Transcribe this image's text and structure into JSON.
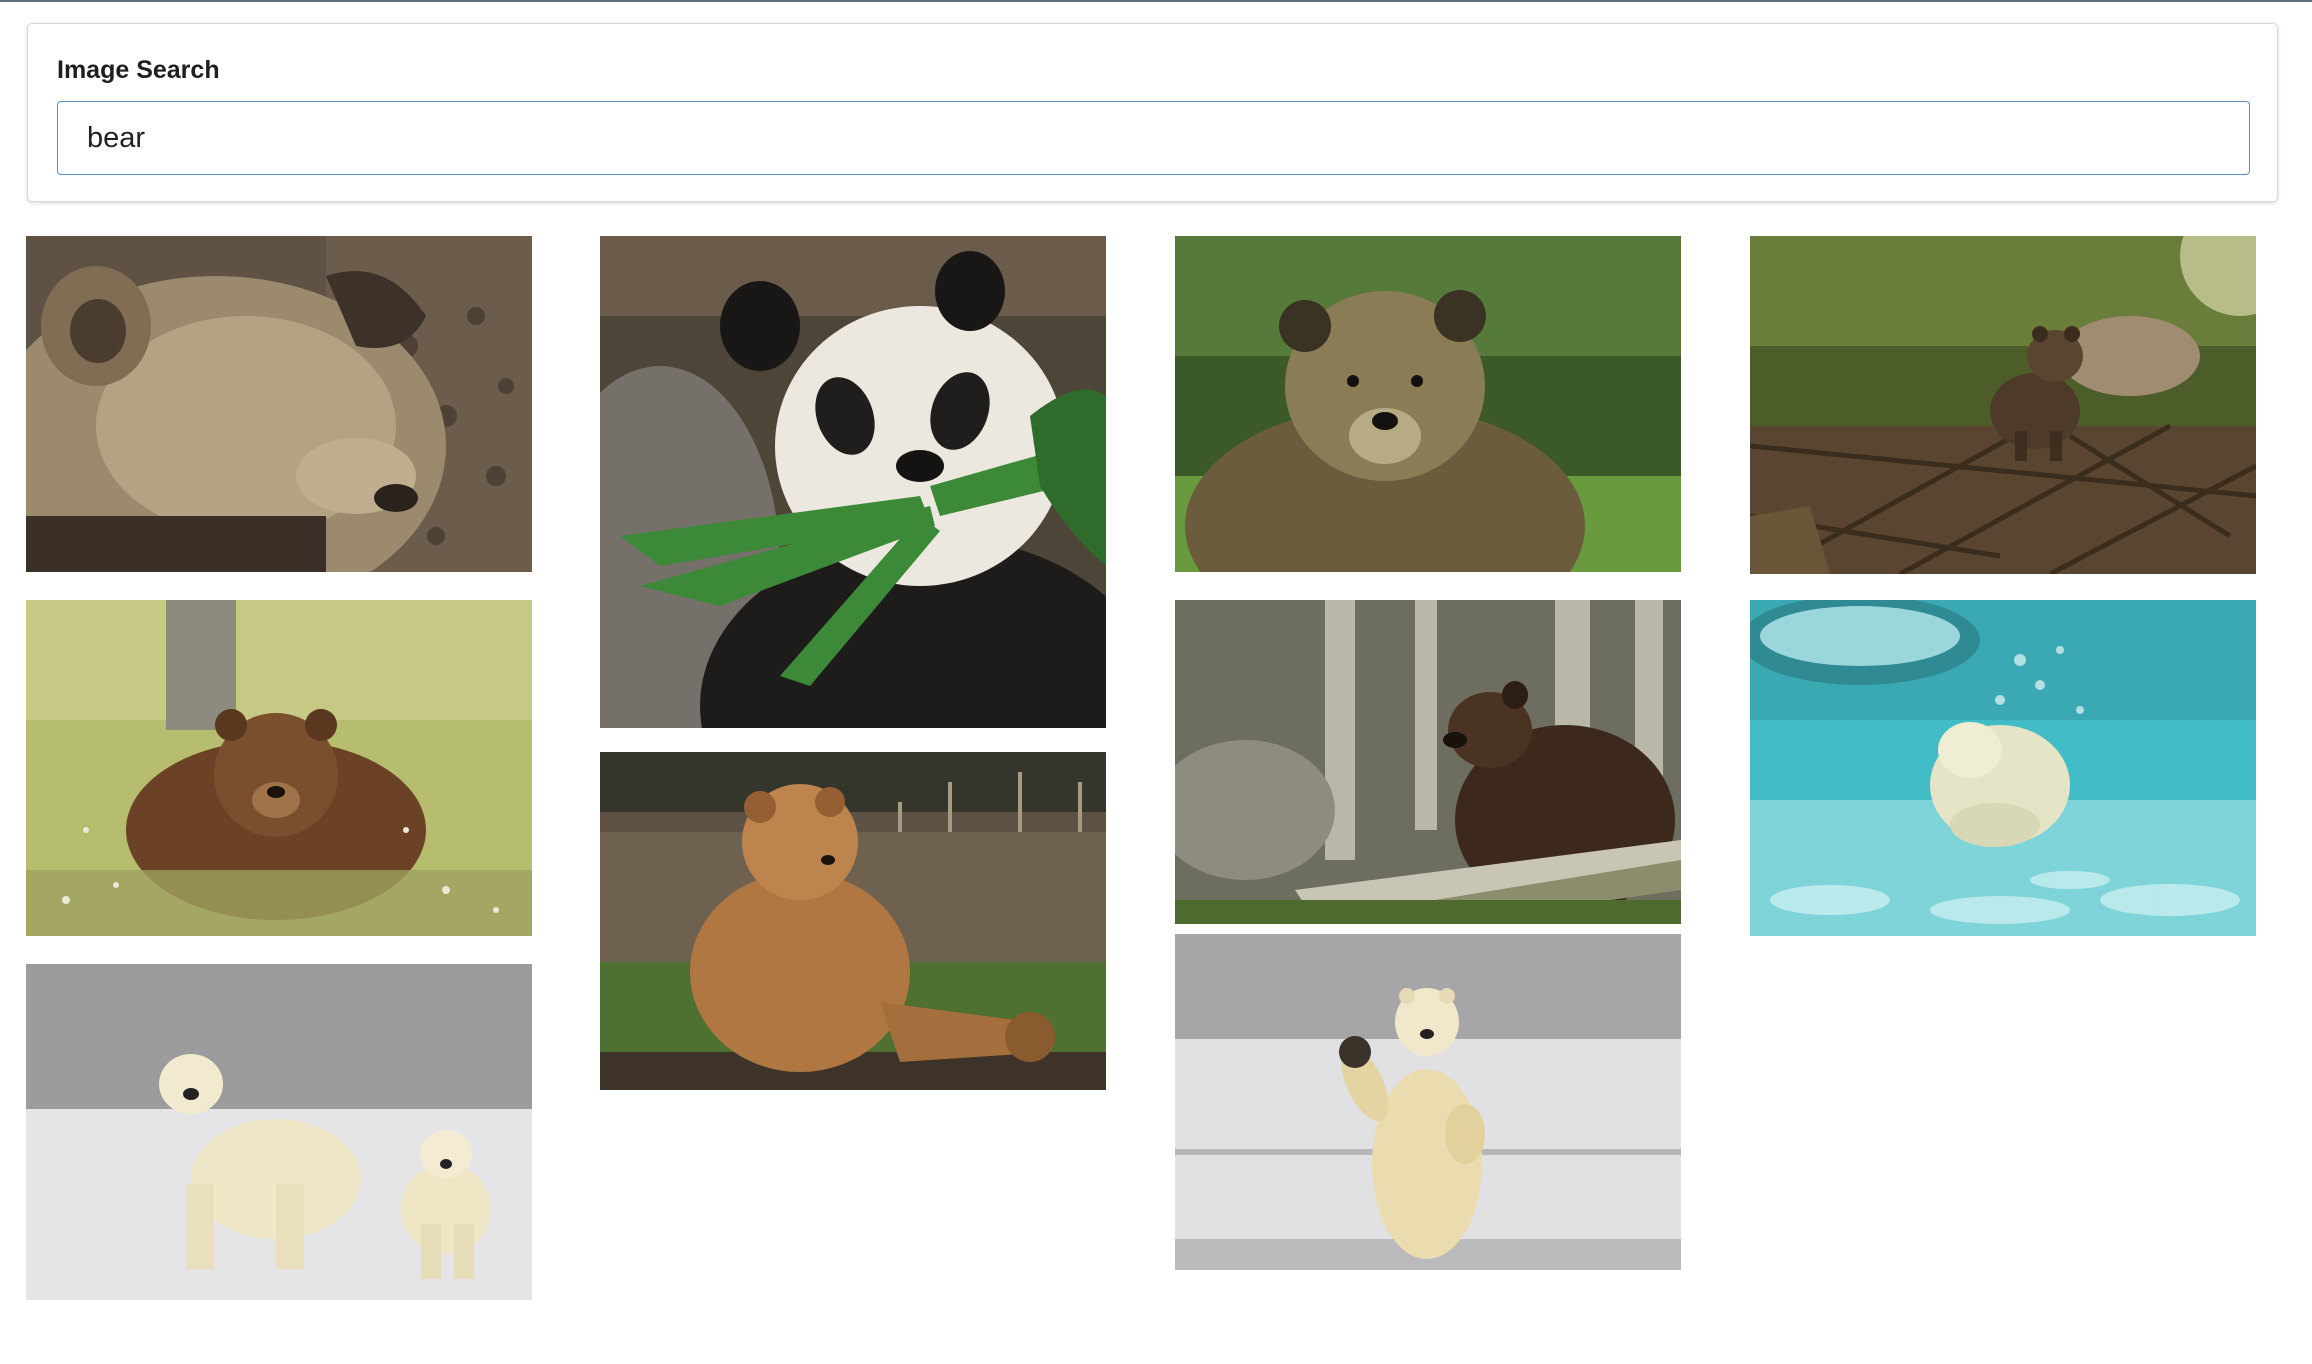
{
  "search": {
    "label": "Image Search",
    "value": "bear",
    "placeholder": ""
  },
  "results": [
    {
      "subject": "grizzly-sleeping",
      "colors": [
        "#6f6152",
        "#a89777",
        "#4a3f35"
      ]
    },
    {
      "subject": "giant-panda-eating-bamboo",
      "colors": [
        "#2c2a25",
        "#eeeae2",
        "#3e8a3a"
      ]
    },
    {
      "subject": "brown-bear-forest",
      "colors": [
        "#4d6b2e",
        "#7b6e4a",
        "#2f3a22"
      ]
    },
    {
      "subject": "bear-cub-on-branches",
      "colors": [
        "#556b2f",
        "#6e5a3e",
        "#2c2418"
      ]
    },
    {
      "subject": "brown-bear-in-meadow",
      "colors": [
        "#b9bd6b",
        "#5a3a22",
        "#7c7b4e"
      ]
    },
    {
      "subject": "bear-sitting-in-grass",
      "colors": [
        "#5a5040",
        "#b27a44",
        "#4d6e2e"
      ]
    },
    {
      "subject": "brown-bear-behind-log",
      "colors": [
        "#6b6a5c",
        "#3e2a1c",
        "#8b8d6c"
      ]
    },
    {
      "subject": "polar-bear-swimming",
      "colors": [
        "#4cc6cf",
        "#9fe0e4",
        "#e8ead4"
      ]
    },
    {
      "subject": "polar-bear-mother-and-cub",
      "colors": [
        "#9a9a9c",
        "#e6e6e8",
        "#efe6c6"
      ]
    },
    {
      "subject": "polar-bear-standing-waving",
      "colors": [
        "#a3a3a6",
        "#e2e2e4",
        "#eadbb0"
      ]
    }
  ]
}
